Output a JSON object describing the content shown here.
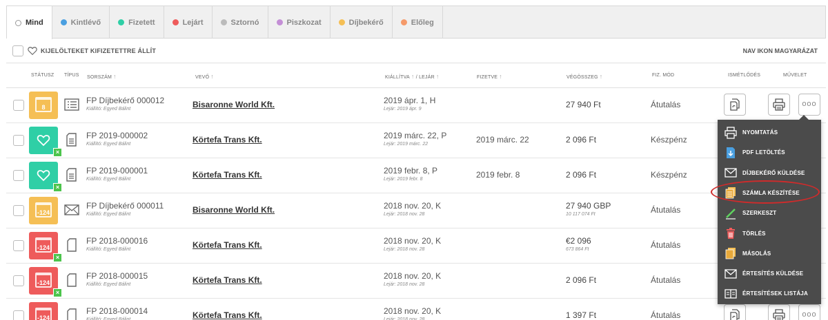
{
  "tabs": [
    {
      "label": "Mind",
      "color": "",
      "active": true
    },
    {
      "label": "Kintlévő",
      "color": "#4a9fe0"
    },
    {
      "label": "Fizetett",
      "color": "#2fcfa6"
    },
    {
      "label": "Lejárt",
      "color": "#ee5b5b"
    },
    {
      "label": "Sztornó",
      "color": "#bbbbbb"
    },
    {
      "label": "Piszkozat",
      "color": "#c48fd6"
    },
    {
      "label": "Díjbekérő",
      "color": "#f5bf55"
    },
    {
      "label": "Előleg",
      "color": "#f59a6a"
    }
  ],
  "toolbar": {
    "bulk_label": "KIJELÖLTEKET KIFIZETETTRE ÁLLÍT",
    "nav_label": "NAV IKON MAGYARÁZAT"
  },
  "headers": {
    "status": "STÁTUSZ",
    "type": "TÍPUS",
    "number": "SORSZÁM",
    "buyer": "VEVŐ",
    "issued": "KIÁLLÍTVA",
    "due": "LEJÁR",
    "paid": "FIZETVE",
    "total": "VÉGÖSSZEG",
    "method": "FIZ. MÓD",
    "recurring": "ISMÉTLŐDÉS",
    "action": "MŰVELET"
  },
  "rows": [
    {
      "status": "yellow",
      "badge": "8",
      "type": "list-icon",
      "number": "FP Díjbekérő 000012",
      "issuer": "Kiállító: Egyed Bálint",
      "buyer": "Bisaronne World Kft.",
      "issued": "2019 ápr. 1, H",
      "due": "Lejár: 2019 ápr. 9",
      "paid": "",
      "total": "27 940 Ft",
      "total_sub": "",
      "method": "Átutalás"
    },
    {
      "status": "teal",
      "badge": "",
      "type": "doc-lines-icon",
      "number": "FP 2019-000002",
      "issuer": "Kiállító: Egyed Bálint",
      "buyer": "Körtefa Trans Kft.",
      "issued": "2019 márc. 22, P",
      "due": "Lejár: 2019 márc. 22",
      "paid": "2019 márc. 22",
      "total": "2 096 Ft",
      "total_sub": "",
      "method": "Készpénz"
    },
    {
      "status": "teal",
      "badge": "",
      "type": "doc-lines-icon",
      "number": "FP 2019-000001",
      "issuer": "Kiállító: Egyed Bálint",
      "buyer": "Körtefa Trans Kft.",
      "issued": "2019 febr. 8, P",
      "due": "Lejár: 2019 febr. 8",
      "paid": "2019 febr. 8",
      "total": "2 096 Ft",
      "total_sub": "",
      "method": "Készpénz"
    },
    {
      "status": "yellow",
      "badge": "-124",
      "type": "envelope-icon",
      "number": "FP Díjbekérő 000011",
      "issuer": "Kiállító: Egyed Bálint",
      "buyer": "Bisaronne World Kft.",
      "issued": "2018 nov. 20, K",
      "due": "Lejár: 2018 nov. 28",
      "paid": "",
      "total": "27 940 GBP",
      "total_sub": "10 117 074 Ft",
      "method": "Átutalás"
    },
    {
      "status": "red",
      "badge": "-124",
      "type": "doc-icon",
      "number": "FP 2018-000016",
      "issuer": "Kiállító: Egyed Bálint",
      "buyer": "Körtefa Trans Kft.",
      "issued": "2018 nov. 20, K",
      "due": "Lejár: 2018 nov. 28",
      "paid": "",
      "total": "€2 096",
      "total_sub": "673 864 Ft",
      "method": "Átutalás"
    },
    {
      "status": "red",
      "badge": "-124",
      "type": "doc-icon",
      "number": "FP 2018-000015",
      "issuer": "Kiállító: Egyed Bálint",
      "buyer": "Körtefa Trans Kft.",
      "issued": "2018 nov. 20, K",
      "due": "Lejár: 2018 nov. 28",
      "paid": "",
      "total": "2 096 Ft",
      "total_sub": "",
      "method": "Átutalás"
    },
    {
      "status": "red",
      "badge": "-124",
      "type": "doc-icon",
      "number": "FP 2018-000014",
      "issuer": "Kiállító: Egyed Bálint",
      "buyer": "Körtefa Trans Kft.",
      "issued": "2018 nov. 20, K",
      "due": "Lejár: 2018 nov. 28",
      "paid": "",
      "total": "1 397 Ft",
      "total_sub": "",
      "method": "Átutalás"
    }
  ],
  "menu": [
    {
      "label": "NYOMTATÁS",
      "icon": "printer-icon"
    },
    {
      "label": "PDF LETÖLTÉS",
      "icon": "pdf-download-icon"
    },
    {
      "label": "DÍJBEKÉRŐ KÜLDÉSE",
      "icon": "envelope-icon"
    },
    {
      "label": "SZÁMLA KÉSZÍTÉSE",
      "icon": "create-invoice-icon"
    },
    {
      "label": "SZERKESZT",
      "icon": "pencil-icon"
    },
    {
      "label": "TÖRLÉS",
      "icon": "trash-icon"
    },
    {
      "label": "MÁSOLÁS",
      "icon": "copy-icon"
    },
    {
      "label": "ÉRTESÍTÉS KÜLDÉSE",
      "icon": "envelope-icon"
    },
    {
      "label": "ÉRTESÍTÉSEK LISTÁJA",
      "icon": "book-icon"
    }
  ]
}
